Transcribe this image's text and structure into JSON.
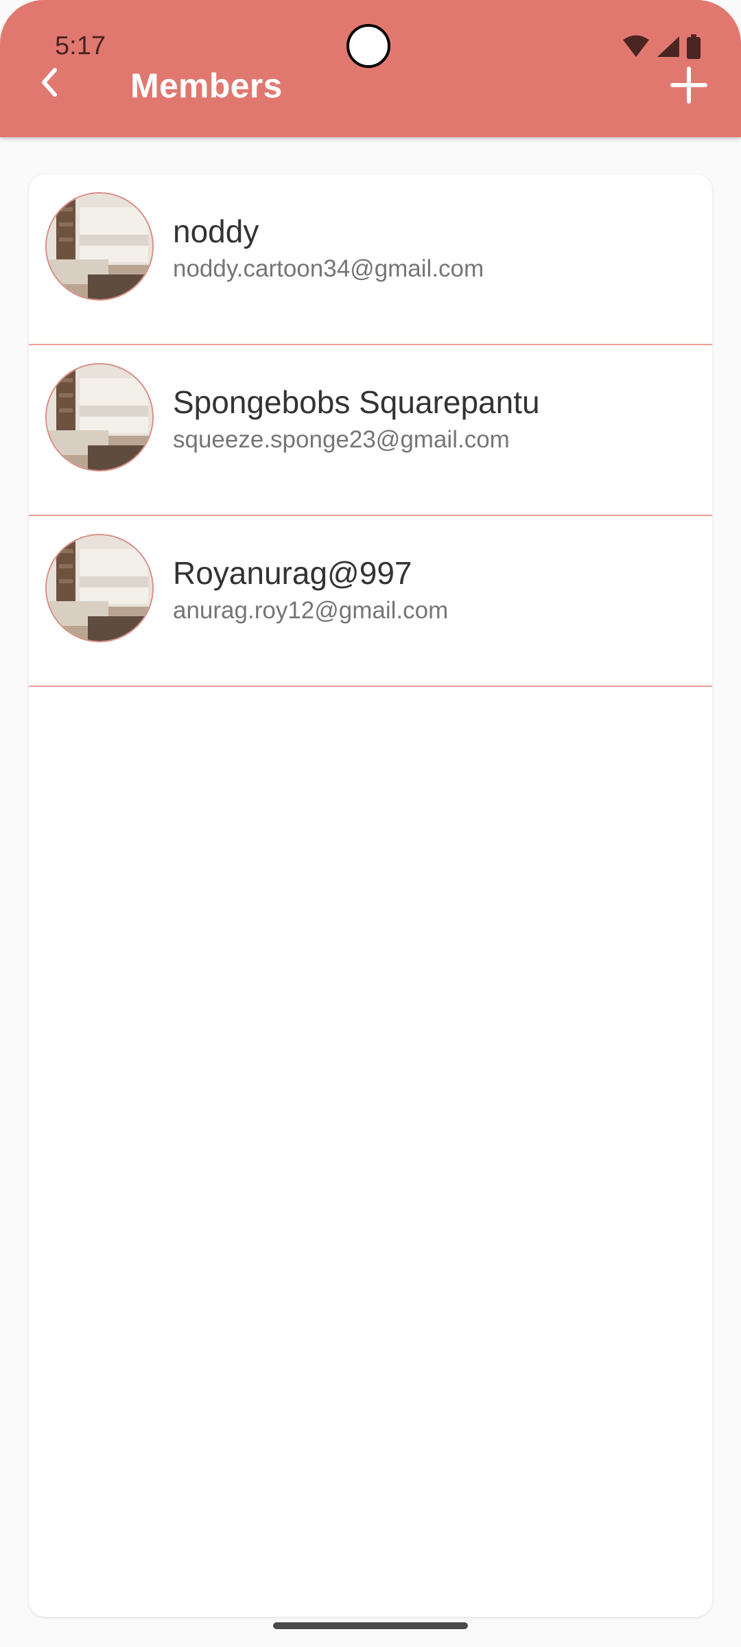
{
  "status_bar": {
    "time": "5:17",
    "icons": [
      "wifi-icon",
      "signal-icon",
      "battery-icon"
    ]
  },
  "app_bar": {
    "title": "Members",
    "back_icon": "chevron-left-icon",
    "add_icon": "plus-icon",
    "color": "#e07870"
  },
  "members": [
    {
      "name": "noddy",
      "email": "noddy.cartoon34@gmail.com"
    },
    {
      "name": "Spongebobs Squarepantu",
      "email": "squeeze.sponge23@gmail.com"
    },
    {
      "name": "Royanurag@997",
      "email": "anurag.roy12@gmail.com"
    }
  ],
  "colors": {
    "divider": "#ef9d97",
    "name_text": "#333333",
    "email_text": "#757575"
  }
}
